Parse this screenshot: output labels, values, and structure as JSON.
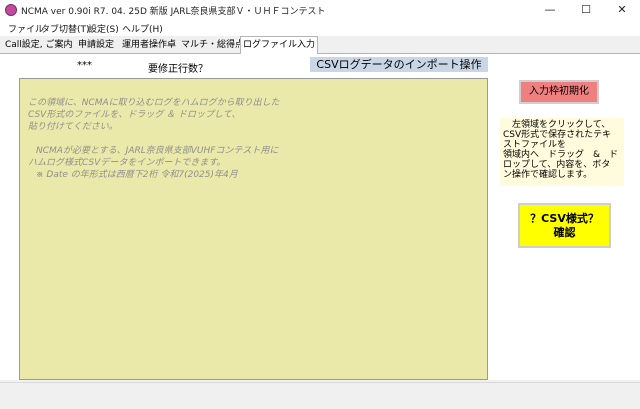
{
  "window": {
    "title": "NCMA ver 0.90i  R7. 04. 25D 新版 JARL奈良県支部Ｖ・ＵＨＦコンテスト",
    "minimize": "—",
    "maximize": "☐",
    "close": "✕"
  },
  "menu": [
    "ファイル",
    "タブ切替(T)",
    "設定(S)",
    "ヘルプ(H)"
  ],
  "tabs": [
    "Call設定, ご案内",
    "申請設定",
    "運用者操作卓",
    "マルチ・総得点",
    "ログファイル入力"
  ],
  "active_tab": "ログファイル入力",
  "header": {
    "stars": "***",
    "rows_label": "要修正行数？",
    "section_title": "CSVログデータのインポート操作"
  },
  "drop_area": {
    "lines": [
      "この領域に、NCMAに取り込むログをハムログから取り出した",
      "CSV形式のファイルを、ドラッグ ＆ ドロップして、",
      "貼り付けてください。",
      "",
      "NCMAが必要とする、JARL奈良県支部VUHFコンテスト用に",
      "ハムログ様式CSVデータをインポートできます。",
      "※ Date の年形式は西暦下2桁  令和7(2025)年4月"
    ]
  },
  "buttons": {
    "reset": "入力枠初期化",
    "csv_check_line1": "？CSV様式？",
    "csv_check_line2": "確認"
  },
  "help": {
    "lines": [
      "　左領域をクリックして、",
      "CSV形式で保存されたテキ",
      "ストファイルを",
      "領域内へ　ドラッグ　&　ド",
      "ロップして、内容を、ボタ",
      "ン操作で確認します。"
    ]
  },
  "colors": {
    "drop_area_bg": "#ebe9a9",
    "reset_button": "#f07f7f",
    "csv_button": "#ffff00",
    "section_title_bg": "#c9d6e6",
    "help_bg": "#fffbdc"
  }
}
